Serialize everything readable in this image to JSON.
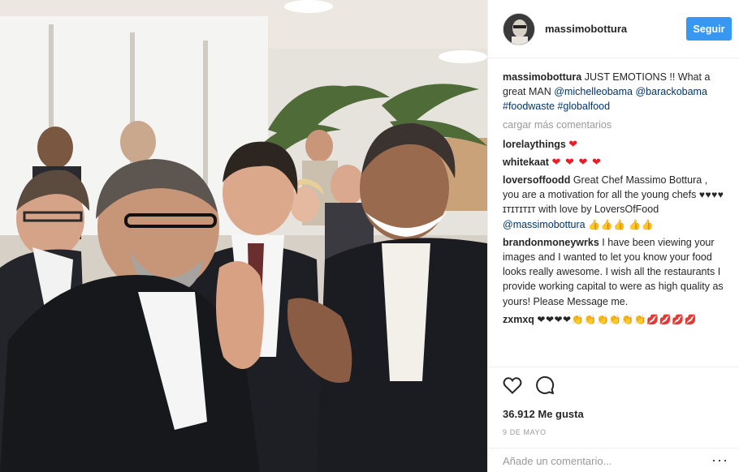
{
  "post": {
    "username": "massimobottura",
    "follow_label": "Seguir",
    "caption": {
      "user": "massimobottura",
      "text": "JUST EMOTIONS !! What a great MAN",
      "mention1": "@michelleobama",
      "mention2": "@barackobama",
      "hashtag1": "#foodwaste",
      "hashtag2": "#globalfood"
    },
    "load_more": "cargar más comentarios",
    "comments": [
      {
        "user": "lorelaythings",
        "text": "",
        "emoji": "❤"
      },
      {
        "user": "whitekaat",
        "text": "",
        "emoji": "❤ ❤ ❤ ❤"
      },
      {
        "user": "loversoffoodd",
        "text": "Great Chef Massimo Bottura , you are a motivation for all the young chefs",
        "emoji_mid": "♥♥♥♥",
        "text2": "ɪᴛɪᴛɪᴛɪᴛ with love by LoversOfFood",
        "mention": "@massimobottura",
        "emoji_end": "👍👍👍 👍👍"
      },
      {
        "user": "brandonmoneywrks",
        "text": "I have been viewing your images and I wanted to let you know your food looks really awesome. I wish all the restaurants I provide working capital to were as high quality as yours! Please Message me."
      },
      {
        "user": "zxmxq",
        "text": "",
        "emoji": "❤❤❤❤👏👏👏👏👏👏💋💋💋💋"
      }
    ],
    "icons": {
      "like": "heart-icon",
      "comment": "comment-bubble-icon",
      "more": "more-options-icon"
    },
    "likes": "36.912 Me gusta",
    "date": "9 DE MAYO",
    "add_comment_placeholder": "Añade un comentario...",
    "colors": {
      "follow": "#3897f0",
      "mention": "#003569",
      "heart": "#ed1c24",
      "muted": "#999999"
    }
  }
}
